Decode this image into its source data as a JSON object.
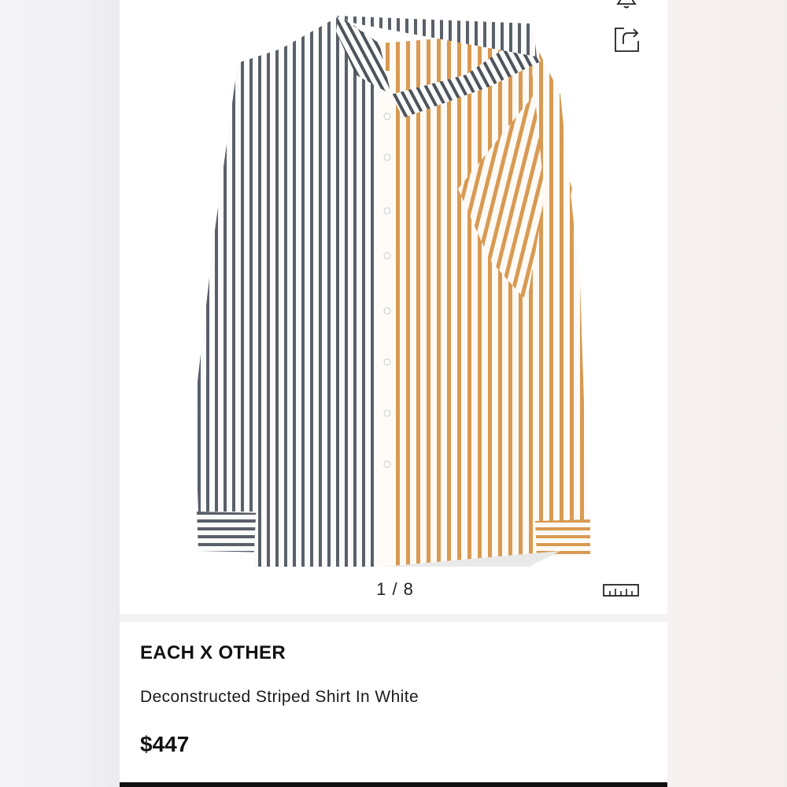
{
  "product": {
    "brand": "EACH X OTHER",
    "name": "Deconstructed Striped Shirt In White",
    "price": "$447"
  },
  "gallery": {
    "page_indicator": "1 / 8"
  },
  "icons": {
    "top_icon": "bell-icon",
    "share": "share-icon",
    "size_guide": "ruler-icon"
  },
  "colors": {
    "left_stripe": "#5a6068",
    "right_stripe": "#d89a52",
    "background": "#ffffff"
  }
}
